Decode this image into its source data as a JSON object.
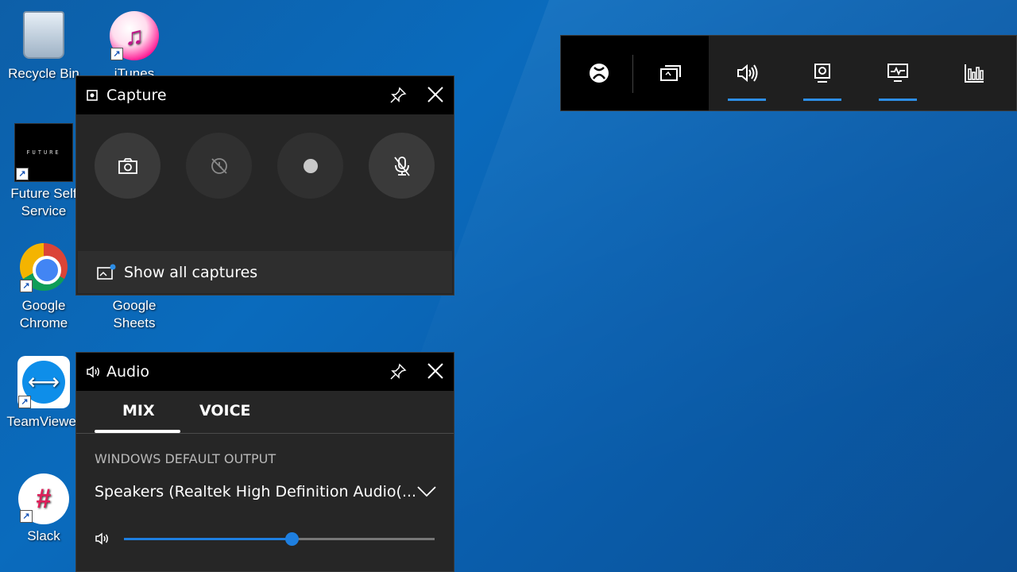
{
  "desktop": {
    "icons": [
      {
        "name": "recycle-bin",
        "label": "Recycle Bin"
      },
      {
        "name": "itunes",
        "label": "iTunes"
      },
      {
        "name": "future-self-service",
        "label1": "Future Self",
        "label2": "Service",
        "thumb_text": "FUTURE"
      },
      {
        "name": "google-chrome",
        "label1": "Google",
        "label2": "Chrome"
      },
      {
        "name": "google-sheets",
        "label1": "Google",
        "label2": "Sheets"
      },
      {
        "name": "teamviewer",
        "label": "TeamViewer"
      },
      {
        "name": "slack",
        "label": "Slack"
      }
    ],
    "background_color": "#0a6bbd"
  },
  "gamebar": {
    "buttons": [
      "xbox-icon",
      "widget-menu-icon",
      "audio-icon",
      "capture-icon",
      "performance-icon",
      "resources-icon"
    ],
    "accent": "#2d8ee7"
  },
  "capture_widget": {
    "title": "Capture",
    "buttons": [
      "screenshot",
      "record-last",
      "record",
      "mic-off"
    ],
    "show_all": "Show all captures"
  },
  "audio_widget": {
    "title": "Audio",
    "tabs": [
      "MIX",
      "VOICE"
    ],
    "active_tab": "MIX",
    "section_label": "WINDOWS DEFAULT OUTPUT",
    "device": "Speakers (Realtek High Definition Audio(...",
    "volume_fraction": 0.54,
    "accent": "#1e7fe0"
  }
}
